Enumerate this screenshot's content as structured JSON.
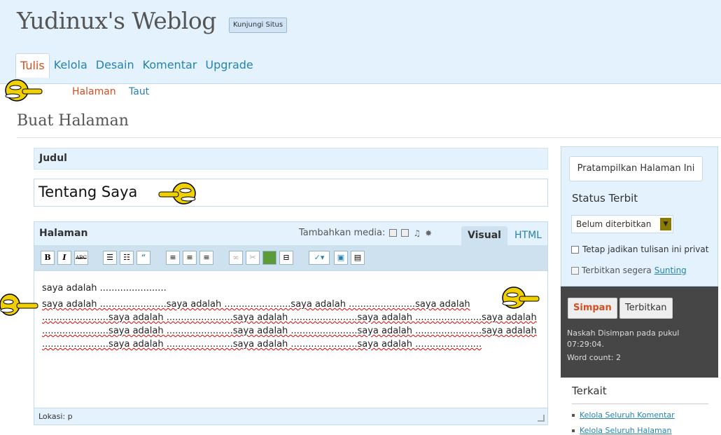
{
  "header": {
    "site_title": "Yudinux's Weblog",
    "visit_site": "Kunjungi Situs",
    "nav": [
      {
        "label": "Tulis",
        "active": true
      },
      {
        "label": "Kelola",
        "active": false
      },
      {
        "label": "Desain",
        "active": false
      },
      {
        "label": "Komentar",
        "active": false
      },
      {
        "label": "Upgrade",
        "active": false
      }
    ]
  },
  "subnav": {
    "items": [
      {
        "label": "Halaman",
        "active": true
      },
      {
        "label": "Taut",
        "active": false
      }
    ]
  },
  "page_title": "Buat Halaman",
  "title_section": {
    "label": "Judul",
    "value": "Tentang Saya"
  },
  "editor": {
    "label": "Halaman",
    "media_label": "Tambahkan media:",
    "tab_visual": "Visual",
    "tab_html": "HTML",
    "toolbar": {
      "bold": "B",
      "italic": "I",
      "strike": "ABC",
      "quote": "“"
    },
    "line1": "saya adalah .......................",
    "para": "saya adalah .......................saya adalah .......................saya adalah .......................saya adalah .......................saya adalah .......................saya adalah .......................saya adalah .......................saya adalah .......................saya adalah .......................saya adalah .......................saya adalah .......................saya adalah .......................saya adalah .......................saya adalah .......................saya adalah .......................",
    "status": "Lokasi: p"
  },
  "sidebar": {
    "preview_button": "Pratampilkan Halaman Ini",
    "status_heading": "Status Terbit",
    "status_select": "Belum diterbitkan",
    "private_label": "Tetap jadikan tulisan ini privat",
    "publish_text": "Terbitkan segera",
    "edit_link": "Sunting",
    "save_button": "Simpan",
    "publish_button": "Terbitkan",
    "saved_text": "Naskah Disimpan pada pukul 07:29:04.",
    "word_count": "Word count: 2",
    "related_heading": "Terkait",
    "related": [
      "Kelola Seluruh Komentar",
      "Kelola Seluruh Halaman"
    ]
  },
  "colors": {
    "header_bg": "#e4f2fd",
    "link": "#2583ad",
    "active": "#d54e21",
    "dark_box": "#464646"
  },
  "icons": [
    "pointing-hand-mascot-icon",
    "calendar-icon",
    "dropdown-arrow-icon"
  ]
}
